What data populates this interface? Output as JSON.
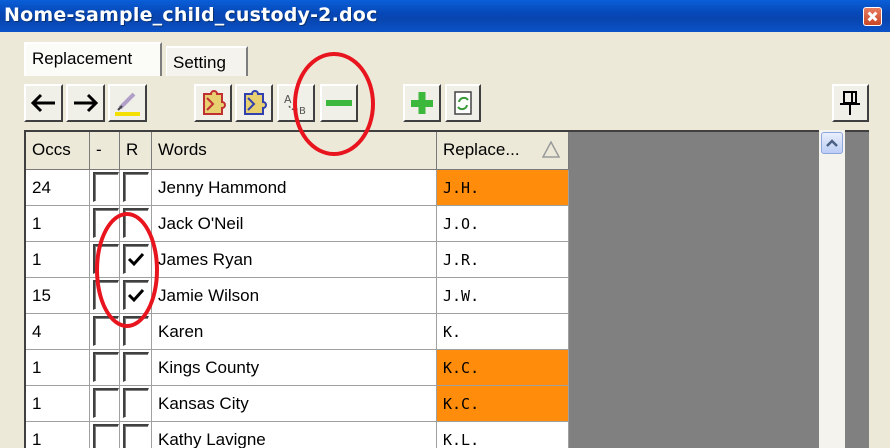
{
  "window": {
    "title": "Nome-sample_child_custody-2.doc"
  },
  "tabs": [
    {
      "label": "Replacement",
      "active": true
    },
    {
      "label": "Setting",
      "active": false
    }
  ],
  "toolbar": {
    "buttons": [
      {
        "icon": "arrow-left-icon"
      },
      {
        "icon": "arrow-right-icon"
      },
      {
        "icon": "highlighter-icon"
      },
      {
        "icon": "puzzle-red-icon"
      },
      {
        "icon": "puzzle-blue-icon"
      },
      {
        "icon": "replace-ab-icon"
      },
      {
        "icon": "minus-icon"
      },
      {
        "icon": "plus-icon"
      },
      {
        "icon": "refresh-icon"
      }
    ],
    "pin_icon": "pin-icon"
  },
  "grid": {
    "columns": [
      "Occs",
      "-",
      "R",
      "Words",
      "Replace..."
    ],
    "rows": [
      {
        "occs": "24",
        "minus": false,
        "r": false,
        "word": "Jenny Hammond",
        "replace": "J.H.",
        "highlight": true
      },
      {
        "occs": "1",
        "minus": false,
        "r": false,
        "word": "Jack O'Neil",
        "replace": "J.O.",
        "highlight": false
      },
      {
        "occs": "1",
        "minus": false,
        "r": true,
        "word": "James Ryan",
        "replace": "J.R.",
        "highlight": false
      },
      {
        "occs": "15",
        "minus": false,
        "r": true,
        "word": "Jamie Wilson",
        "replace": "J.W.",
        "highlight": false
      },
      {
        "occs": "4",
        "minus": false,
        "r": false,
        "word": "Karen",
        "replace": "K.",
        "highlight": false
      },
      {
        "occs": "1",
        "minus": false,
        "r": false,
        "word": "Kings County",
        "replace": "K.C.",
        "highlight": true
      },
      {
        "occs": "1",
        "minus": false,
        "r": false,
        "word": "Kansas City",
        "replace": "K.C.",
        "highlight": true
      },
      {
        "occs": "1",
        "minus": false,
        "r": false,
        "word": "Kathy Lavigne",
        "replace": "K.L.",
        "highlight": false
      }
    ]
  },
  "colors": {
    "highlight": "#ff8c0a",
    "annotation": "#e8141e",
    "titlebar": "#0648b8"
  }
}
